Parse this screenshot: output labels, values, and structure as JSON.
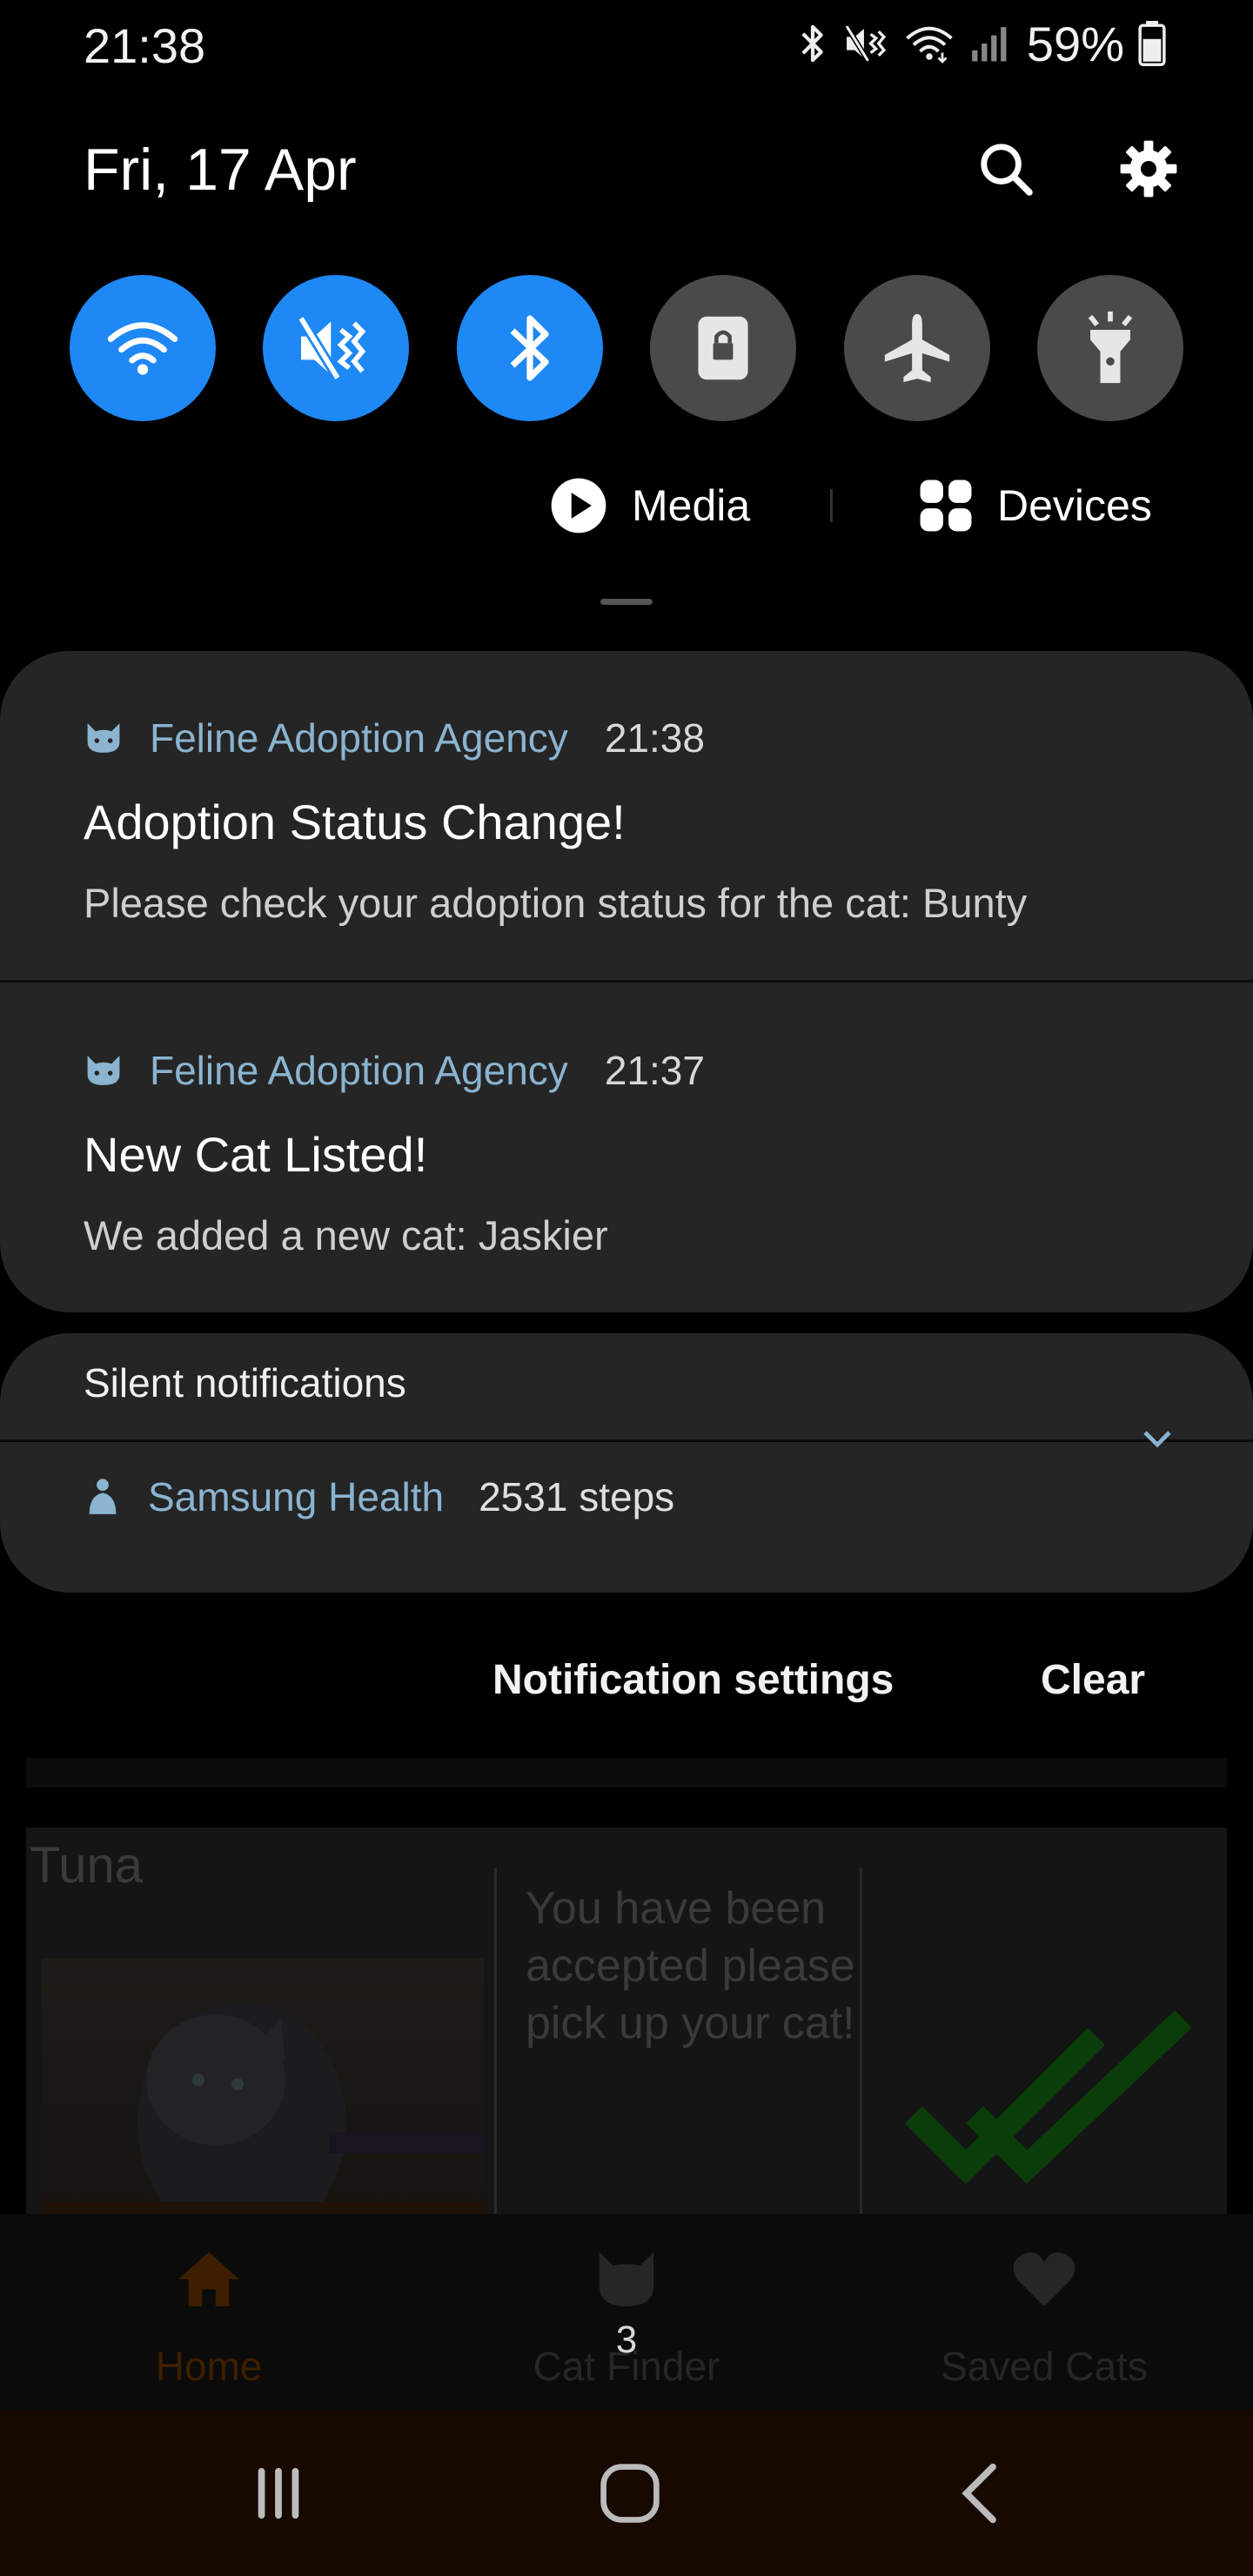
{
  "status_bar": {
    "time": "21:38",
    "battery": "59%",
    "icons": [
      "bluetooth-icon",
      "vibrate-mute-icon",
      "wifi-icon",
      "signal-icon",
      "battery-icon"
    ]
  },
  "panel": {
    "date": "Fri, 17 Apr",
    "search_icon": "search-icon",
    "settings_icon": "gear-icon"
  },
  "quick_toggles": [
    {
      "name": "Wi-Fi",
      "icon": "wifi-icon",
      "on": true
    },
    {
      "name": "Sound",
      "icon": "mute-icon",
      "on": true
    },
    {
      "name": "Bluetooth",
      "icon": "bluetooth-icon",
      "on": true
    },
    {
      "name": "Portrait",
      "icon": "rotation-lock-icon",
      "on": false
    },
    {
      "name": "Airplane mode",
      "icon": "airplane-icon",
      "on": false
    },
    {
      "name": "Flashlight",
      "icon": "flashlight-icon",
      "on": false
    }
  ],
  "media_row": {
    "media_label": "Media",
    "devices_label": "Devices"
  },
  "notifications": [
    {
      "app": "Feline Adoption Agency",
      "time": "21:38",
      "title": "Adoption Status Change!",
      "body": "Please check your adoption status for the cat: Bunty"
    },
    {
      "app": "Feline Adoption Agency",
      "time": "21:37",
      "title": "New Cat Listed!",
      "body": "We added a new cat: Jaskier"
    }
  ],
  "silent": {
    "header": "Silent notifications",
    "app": "Samsung Health",
    "summary": "2531 steps"
  },
  "actions": {
    "settings_label": "Notification settings",
    "clear_label": "Clear"
  },
  "background_app": {
    "cat_name": "Tuna",
    "message": "You have been accepted please pick up your cat!",
    "nav": [
      {
        "label": "Home",
        "icon": "home-icon",
        "active": true
      },
      {
        "label": "Cat Finder",
        "icon": "cat-icon",
        "active": false,
        "badge": "3"
      },
      {
        "label": "Saved Cats",
        "icon": "heart-icon",
        "active": false
      }
    ]
  },
  "colors": {
    "accent": "#1e88f5",
    "card": "#252525",
    "app_name": "#8ab4d0",
    "active_nav": "#3d1f00",
    "check": "#0b3d0b"
  }
}
